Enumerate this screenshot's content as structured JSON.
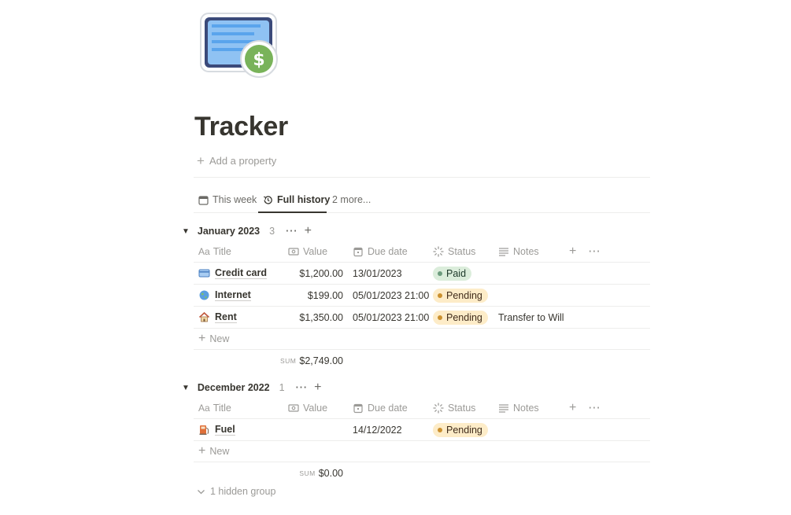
{
  "page": {
    "title": "Tracker",
    "icon": "invoice-dollar-icon",
    "add_property": "Add a property"
  },
  "views": {
    "tabs": [
      {
        "label": "This week",
        "icon": "calendar-icon"
      },
      {
        "label": "Full history",
        "icon": "history-icon",
        "active": true
      }
    ],
    "more": "2 more..."
  },
  "columns": {
    "title": "Title",
    "value": "Value",
    "due": "Due date",
    "status": "Status",
    "notes": "Notes"
  },
  "groups": [
    {
      "name": "January 2023",
      "count": "3",
      "rows": [
        {
          "title": "Credit card",
          "icon": "credit-card-icon",
          "value": "$1,200.00",
          "due": "13/01/2023",
          "status": "Paid",
          "notes": ""
        },
        {
          "title": "Internet",
          "icon": "globe-icon",
          "value": "$199.00",
          "due": "05/01/2023 21:00",
          "status": "Pending",
          "notes": ""
        },
        {
          "title": "Rent",
          "icon": "house-icon",
          "value": "$1,350.00",
          "due": "05/01/2023 21:00",
          "status": "Pending",
          "notes": "Transfer to Will"
        }
      ],
      "new_label": "New",
      "sum_label": "SUM",
      "sum_value": "$2,749.00"
    },
    {
      "name": "December 2022",
      "count": "1",
      "rows": [
        {
          "title": "Fuel",
          "icon": "fuel-pump-icon",
          "value": "",
          "due": "14/12/2022",
          "status": "Pending",
          "notes": ""
        }
      ],
      "new_label": "New",
      "sum_label": "SUM",
      "sum_value": "$0.00"
    }
  ],
  "hidden_groups": "1 hidden group",
  "colors": {
    "paid_bg": "#dbeddb",
    "pending_bg": "#fdecc8",
    "text": "#37352f",
    "muted": "#9b9a97"
  }
}
